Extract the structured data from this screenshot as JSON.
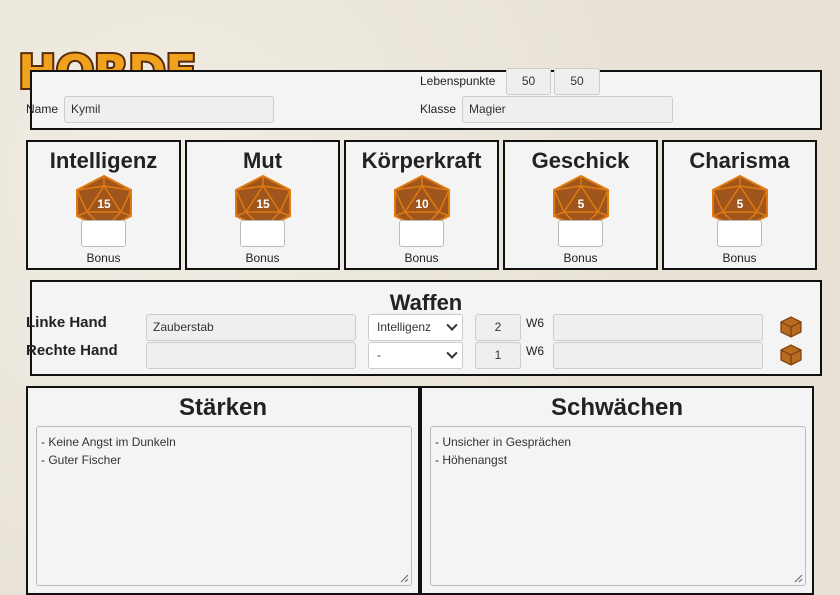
{
  "logo": {
    "text": "HORDE"
  },
  "header": {
    "name_label": "Name",
    "name_value": "Kymil",
    "hp_label": "Lebenspunkte",
    "hp_current": "50",
    "hp_max": "50",
    "class_label": "Klasse",
    "class_value": "Magier"
  },
  "stats": [
    {
      "name": "Intelligenz",
      "value": "15",
      "bonus_label": "Bonus"
    },
    {
      "name": "Mut",
      "value": "15",
      "bonus_label": "Bonus"
    },
    {
      "name": "Körperkraft",
      "value": "10",
      "bonus_label": "Bonus"
    },
    {
      "name": "Geschick",
      "value": "5",
      "bonus_label": "Bonus"
    },
    {
      "name": "Charisma",
      "value": "5",
      "bonus_label": "Bonus"
    }
  ],
  "weapons": {
    "title": "Waffen",
    "left": {
      "label": "Linke Hand",
      "weapon": "Zauberstab",
      "attribute": "Intelligenz",
      "dice_count": "2",
      "dice_type": "W6",
      "extra": ""
    },
    "right": {
      "label": "Rechte Hand",
      "weapon": "",
      "attribute": "-",
      "dice_count": "1",
      "dice_type": "W6",
      "extra": ""
    }
  },
  "strengths": {
    "title": "Stärken",
    "lines": [
      "- Keine Angst im Dunkeln",
      "- Guter Fischer"
    ]
  },
  "weaknesses": {
    "title": "Schwächen",
    "lines": [
      "- Unsicher in Gesprächen",
      "- Höhenangst"
    ]
  },
  "colors": {
    "die_fill": "#a0551c",
    "die_stroke": "#e07a12",
    "logo_fill": "#f0a21e",
    "logo_outline": "#5a2a0c"
  },
  "icons": {
    "die": "d20-die-icon",
    "roll": "cube-dice-icon"
  }
}
